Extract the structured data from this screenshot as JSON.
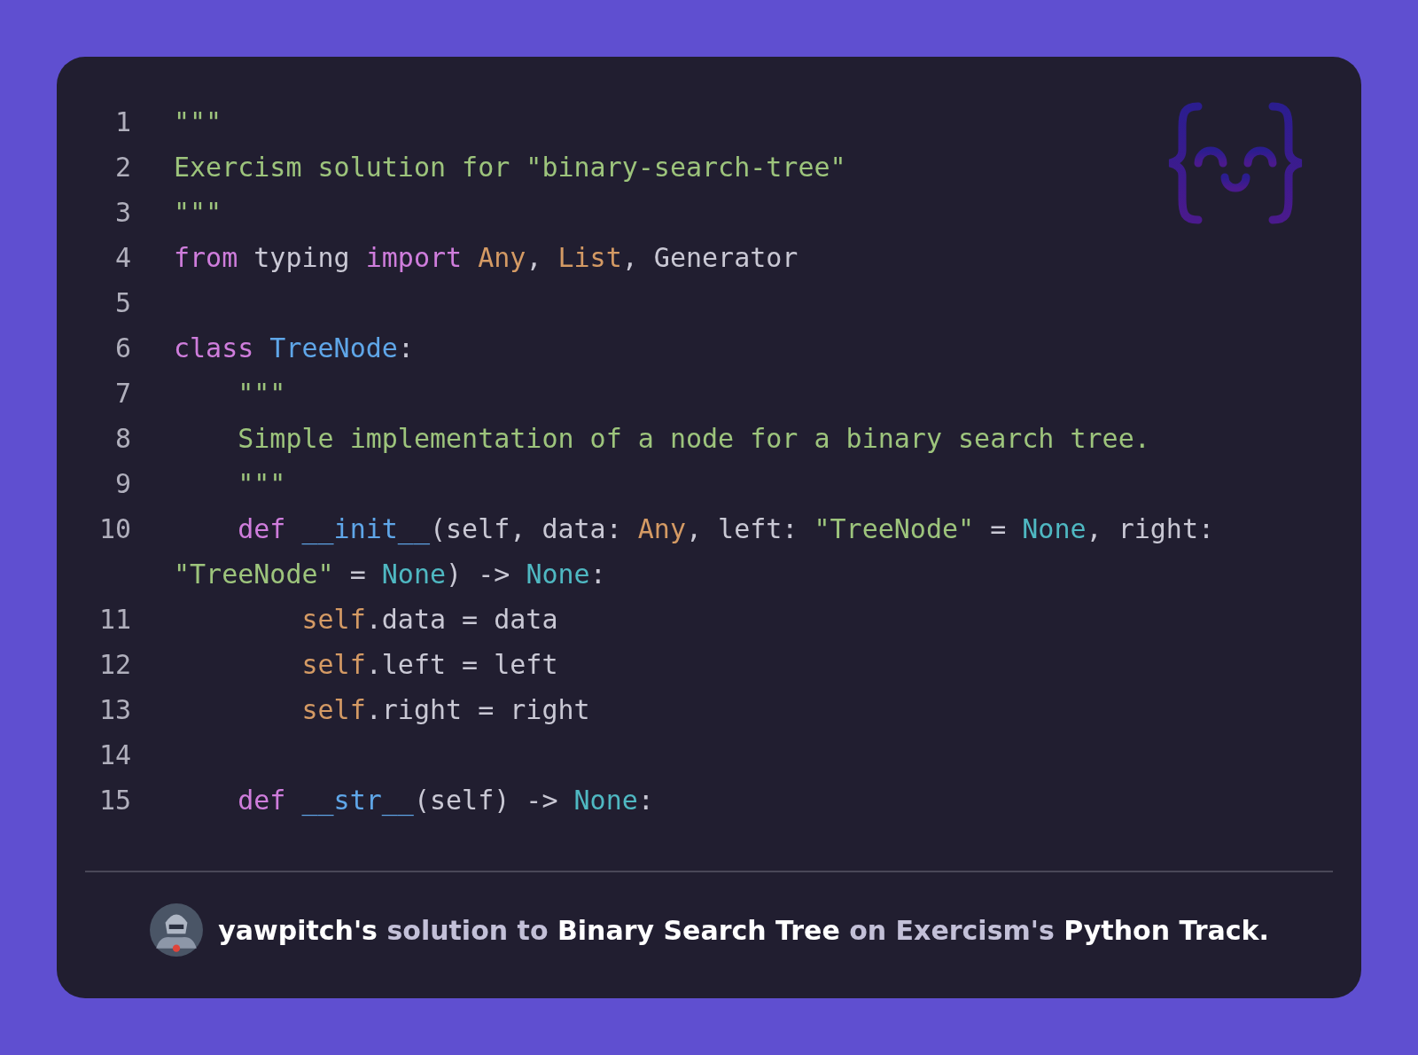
{
  "code": {
    "lines": [
      {
        "number": "1",
        "tokens": [
          {
            "text": "\"\"\"",
            "kind": "string"
          }
        ]
      },
      {
        "number": "2",
        "tokens": [
          {
            "text": "Exercism solution for \"binary-search-tree\"",
            "kind": "string"
          }
        ]
      },
      {
        "number": "3",
        "tokens": [
          {
            "text": "\"\"\"",
            "kind": "string"
          }
        ]
      },
      {
        "number": "4",
        "tokens": [
          {
            "text": "from",
            "kind": "keyword"
          },
          {
            "text": " typing ",
            "kind": "plain"
          },
          {
            "text": "import",
            "kind": "keyword"
          },
          {
            "text": " Any",
            "kind": "type"
          },
          {
            "text": ", ",
            "kind": "plain"
          },
          {
            "text": "List",
            "kind": "type"
          },
          {
            "text": ", Generator",
            "kind": "plain"
          }
        ]
      },
      {
        "number": "5"
      },
      {
        "number": "6",
        "tokens": [
          {
            "text": "class",
            "kind": "keyword"
          },
          {
            "text": " TreeNode",
            "kind": "name"
          },
          {
            "text": ":",
            "kind": "plain"
          }
        ]
      },
      {
        "number": "7",
        "tokens": [
          {
            "text": "    \"\"\"",
            "kind": "string"
          }
        ]
      },
      {
        "number": "8",
        "tokens": [
          {
            "text": "    Simple implementation of a node for a binary search tree.",
            "kind": "string"
          }
        ]
      },
      {
        "number": "9",
        "tokens": [
          {
            "text": "    \"\"\"",
            "kind": "string"
          }
        ]
      },
      {
        "number": "10",
        "tokens": [
          {
            "text": "    def",
            "kind": "keyword"
          },
          {
            "text": " __init__",
            "kind": "name"
          },
          {
            "text": "(self, data: ",
            "kind": "plain"
          },
          {
            "text": "Any",
            "kind": "type"
          },
          {
            "text": ", left: ",
            "kind": "plain"
          },
          {
            "text": "\"TreeNode\"",
            "kind": "string"
          },
          {
            "text": " = ",
            "kind": "plain"
          },
          {
            "text": "None",
            "kind": "constant"
          },
          {
            "text": ", right:",
            "kind": "plain"
          }
        ],
        "continuation": [
          {
            "text": "\"TreeNode\"",
            "kind": "string"
          },
          {
            "text": " = ",
            "kind": "plain"
          },
          {
            "text": "None",
            "kind": "constant"
          },
          {
            "text": ") -> ",
            "kind": "plain"
          },
          {
            "text": "None",
            "kind": "constant"
          },
          {
            "text": ":",
            "kind": "plain"
          }
        ]
      },
      {
        "number": "11",
        "tokens": [
          {
            "text": "        self",
            "kind": "type"
          },
          {
            "text": ".data = data",
            "kind": "plain"
          }
        ]
      },
      {
        "number": "12",
        "tokens": [
          {
            "text": "        self",
            "kind": "type"
          },
          {
            "text": ".left = left",
            "kind": "plain"
          }
        ]
      },
      {
        "number": "13",
        "tokens": [
          {
            "text": "        self",
            "kind": "type"
          },
          {
            "text": ".right = right",
            "kind": "plain"
          }
        ]
      },
      {
        "number": "14"
      },
      {
        "number": "15",
        "tokens": [
          {
            "text": "    def",
            "kind": "keyword"
          },
          {
            "text": " __str__",
            "kind": "name"
          },
          {
            "text": "(self) -> ",
            "kind": "plain"
          },
          {
            "text": "None",
            "kind": "constant"
          },
          {
            "text": ":",
            "kind": "plain"
          }
        ]
      }
    ]
  },
  "footer": {
    "caption": "**yawpitch's** solution to **Binary Search Tree** on Exercism's **Python Track.**"
  }
}
